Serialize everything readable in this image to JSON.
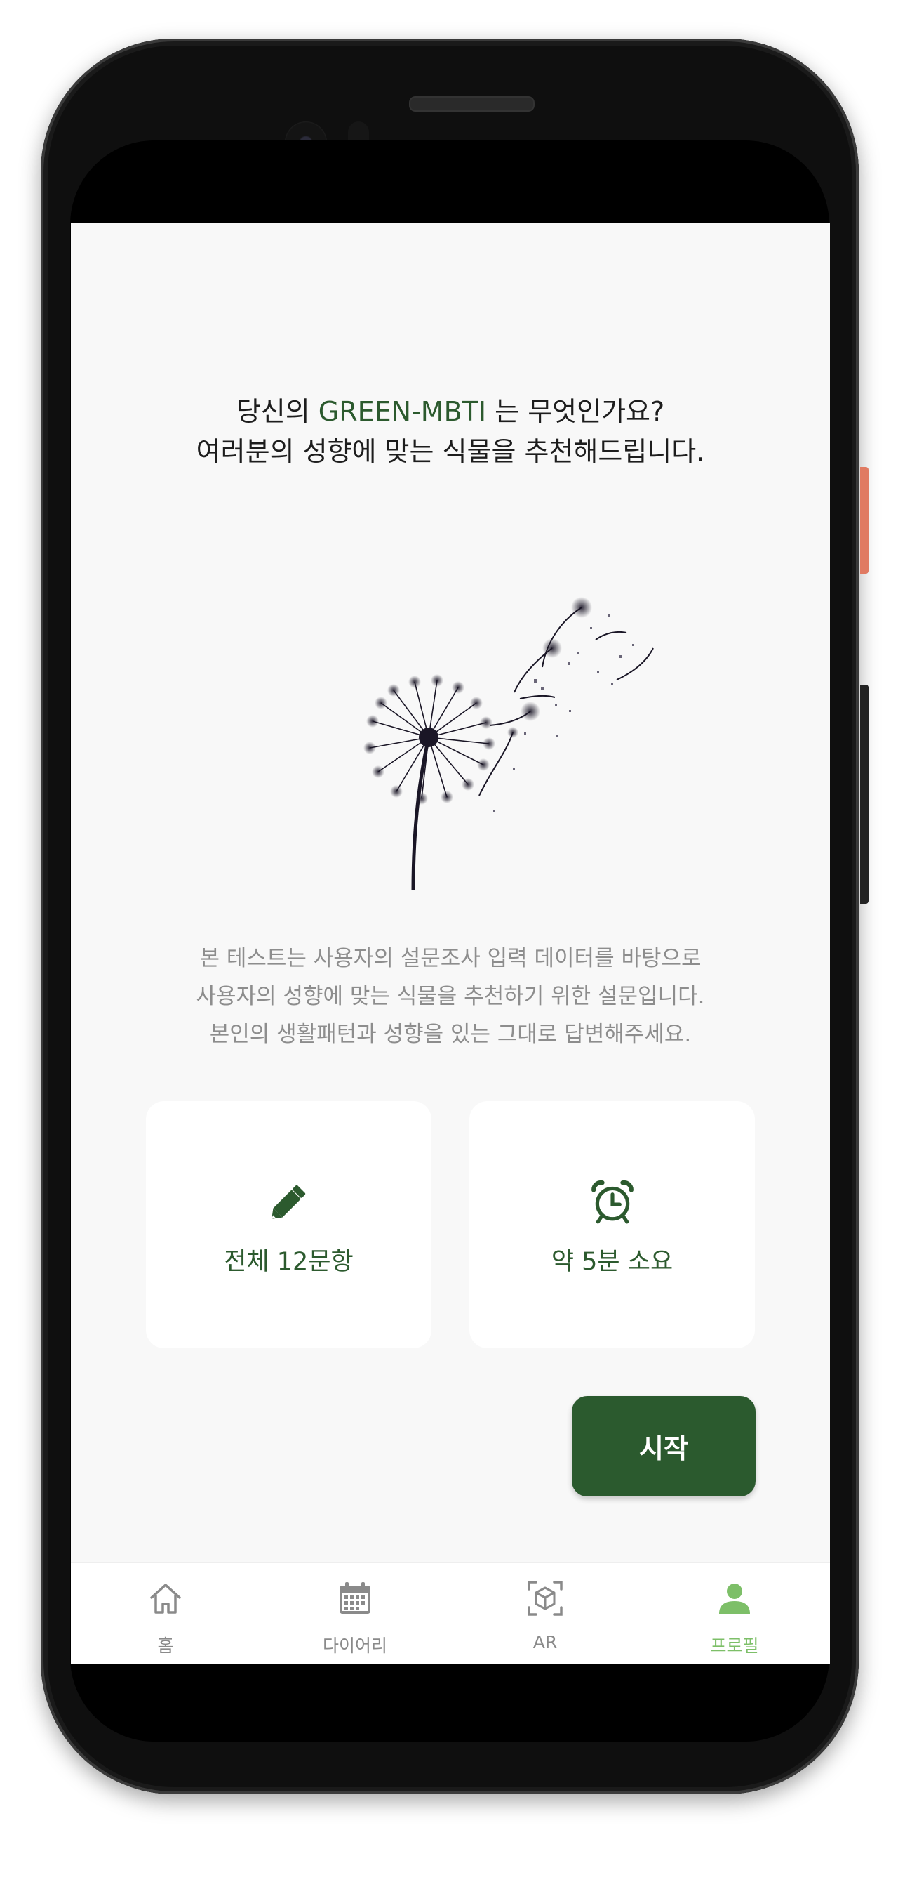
{
  "headline": {
    "line1_prefix": "당신의 ",
    "line1_accent": "GREEN-MBTI",
    "line1_suffix": " 는 무엇인가요?",
    "line2": "여러분의 성향에 맞는 식물을 추천해드립니다."
  },
  "illustration": {
    "icon": "dandelion-illustration"
  },
  "description": {
    "line1": "본 테스트는 사용자의 설문조사 입력 데이터를 바탕으로",
    "line2": "사용자의 성향에 맞는 식물을 추천하기 위한 설문입니다.",
    "line3": "본인의 생활패턴과 성향을 있는 그대로 답변해주세요."
  },
  "cards": [
    {
      "icon": "pencil-icon",
      "label": "전체 12문항"
    },
    {
      "icon": "alarm-clock-icon",
      "label": "약 5분 소요"
    }
  ],
  "start_button": {
    "label": "시작"
  },
  "bottom_nav": {
    "items": [
      {
        "icon": "home-icon",
        "label": "홈",
        "active": false
      },
      {
        "icon": "calendar-icon",
        "label": "다이어리",
        "active": false
      },
      {
        "icon": "ar-cube-icon",
        "label": "AR",
        "active": false
      },
      {
        "icon": "person-icon",
        "label": "프로필",
        "active": true
      }
    ]
  },
  "colors": {
    "accent_green": "#2c5a2e",
    "active_nav_green": "#7dbf68",
    "screen_background": "#f8f8f8",
    "description_gray": "#8d8d8d"
  }
}
